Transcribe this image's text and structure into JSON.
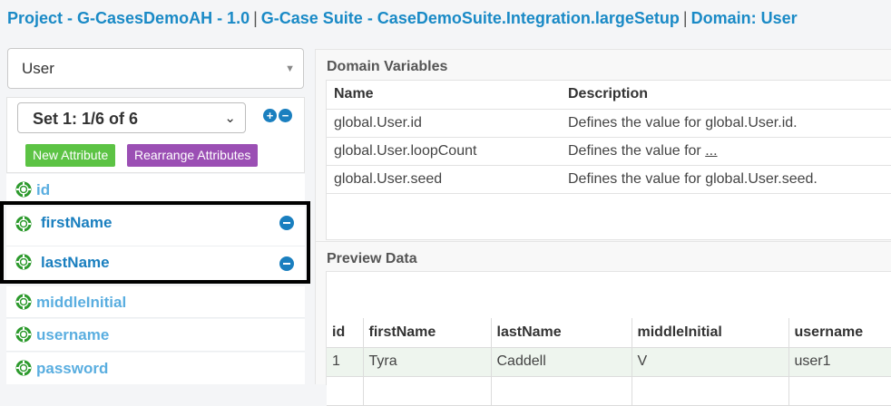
{
  "breadcrumb": {
    "project": "Project - G-CasesDemoAH - 1.0",
    "separator": "|",
    "suite": "G-Case Suite - CaseDemoSuite.Integration.largeSetup",
    "domain": "Domain: User"
  },
  "domain_select": {
    "value": "User"
  },
  "set_panel": {
    "set_label": "Set 1: 1/6 of 6",
    "add_icon": "plus-circle-icon",
    "remove_icon": "minus-circle-icon",
    "new_attribute_label": "New Attribute",
    "rearrange_label": "Rearrange Attributes",
    "colors": {
      "new_attribute": "#5cc344",
      "rearrange": "#9b4fb4",
      "accent": "#1a7fbf"
    }
  },
  "attributes": [
    {
      "name": "id",
      "icon": "lifebuoy-icon",
      "active": false
    },
    {
      "name": "firstName",
      "icon": "lifebuoy-icon",
      "active": true
    },
    {
      "name": "lastName",
      "icon": "lifebuoy-icon",
      "active": true
    },
    {
      "name": "middleInitial",
      "icon": "lifebuoy-icon",
      "active": false
    },
    {
      "name": "username",
      "icon": "lifebuoy-icon",
      "active": false
    },
    {
      "name": "password",
      "icon": "lifebuoy-icon",
      "active": false
    }
  ],
  "domain_variables": {
    "title": "Domain Variables",
    "columns": [
      "Name",
      "Description"
    ],
    "rows": [
      {
        "name": "global.User.id",
        "description": "Defines the value for global.User.id.",
        "link": ""
      },
      {
        "name": "global.User.loopCount",
        "description": "Defines the value for ",
        "link": "..."
      },
      {
        "name": "global.User.seed",
        "description": "Defines the value for global.User.seed.",
        "link": ""
      }
    ]
  },
  "preview": {
    "title": "Preview Data",
    "columns": [
      "id",
      "firstName",
      "lastName",
      "middleInitial",
      "username"
    ],
    "rows": [
      [
        "1",
        "Tyra",
        "Caddell",
        "V",
        "user1"
      ]
    ]
  }
}
